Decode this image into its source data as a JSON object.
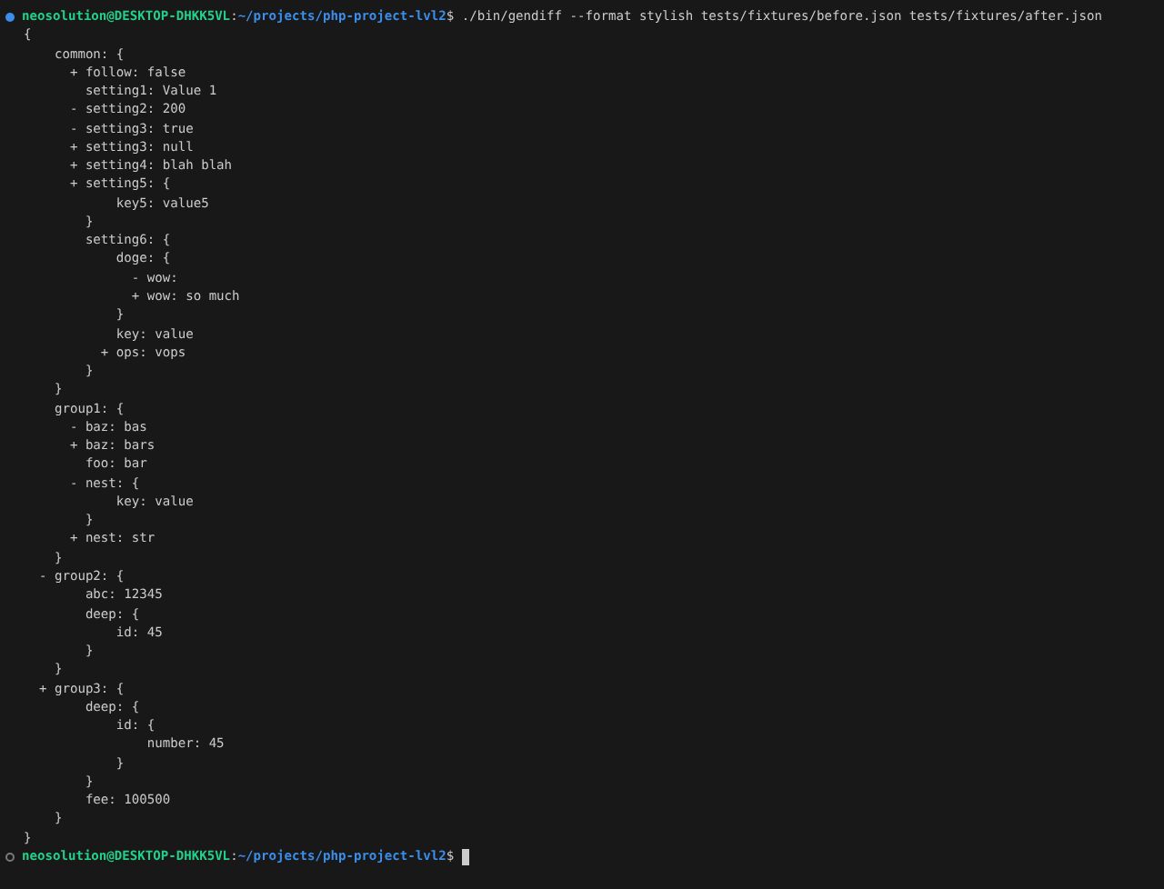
{
  "sessions": [
    {
      "finished": true,
      "user_host": "neosolution@DESKTOP-DHKK5VL",
      "separator": ":",
      "path": "~/projects/php-project-lvl2",
      "symbol": "$",
      "command": "./bin/gendiff --format stylish tests/fixtures/before.json tests/fixtures/after.json",
      "cursor": false,
      "output": {
        "text": "{",
        "close": "}",
        "children": [
          {
            "kind": "unchanged",
            "text": "common: {",
            "close": "}",
            "children": [
              {
                "kind": "added",
                "text": "+ follow: false"
              },
              {
                "kind": "unchanged",
                "text": "setting1: Value 1"
              },
              {
                "kind": "removed",
                "text": "- setting2: 200"
              },
              {
                "kind": "removed",
                "text": "- setting3: true"
              },
              {
                "kind": "added",
                "text": "+ setting3: null"
              },
              {
                "kind": "added",
                "text": "+ setting4: blah blah"
              },
              {
                "kind": "added",
                "text": "+ setting5: {",
                "close": "}",
                "children": [
                  {
                    "kind": "unchanged",
                    "text": "key5: value5"
                  }
                ]
              },
              {
                "kind": "unchanged",
                "text": "setting6: {",
                "close": "}",
                "children": [
                  {
                    "kind": "unchanged",
                    "text": "doge: {",
                    "close": "}",
                    "children": [
                      {
                        "kind": "removed",
                        "text": "- wow:"
                      },
                      {
                        "kind": "added",
                        "text": "+ wow: so much"
                      }
                    ]
                  },
                  {
                    "kind": "unchanged",
                    "text": "key: value"
                  },
                  {
                    "kind": "added",
                    "text": "+ ops: vops"
                  }
                ]
              }
            ]
          },
          {
            "kind": "unchanged",
            "text": "group1: {",
            "close": "}",
            "children": [
              {
                "kind": "removed",
                "text": "- baz: bas"
              },
              {
                "kind": "added",
                "text": "+ baz: bars"
              },
              {
                "kind": "unchanged",
                "text": "foo: bar"
              },
              {
                "kind": "removed",
                "text": "- nest: {",
                "close": "}",
                "children": [
                  {
                    "kind": "unchanged",
                    "text": "key: value"
                  }
                ]
              },
              {
                "kind": "added",
                "text": "+ nest: str"
              }
            ]
          },
          {
            "kind": "removed",
            "text": "- group2: {",
            "close": "}",
            "children": [
              {
                "kind": "unchanged",
                "text": "abc: 12345"
              },
              {
                "kind": "unchanged",
                "text": "deep: {",
                "close": "}",
                "children": [
                  {
                    "kind": "unchanged",
                    "text": "id: 45"
                  }
                ]
              }
            ]
          },
          {
            "kind": "added",
            "text": "+ group3: {",
            "close": "}",
            "children": [
              {
                "kind": "unchanged",
                "text": "deep: {",
                "close": "}",
                "children": [
                  {
                    "kind": "unchanged",
                    "text": "id: {",
                    "close": "}",
                    "children": [
                      {
                        "kind": "unchanged",
                        "text": "number: 45"
                      }
                    ]
                  }
                ]
              },
              {
                "kind": "unchanged",
                "text": "fee: 100500"
              }
            ]
          }
        ]
      }
    },
    {
      "finished": false,
      "user_host": "neosolution@DESKTOP-DHKK5VL",
      "separator": ":",
      "path": "~/projects/php-project-lvl2",
      "symbol": "$",
      "cursor": true
    }
  ]
}
